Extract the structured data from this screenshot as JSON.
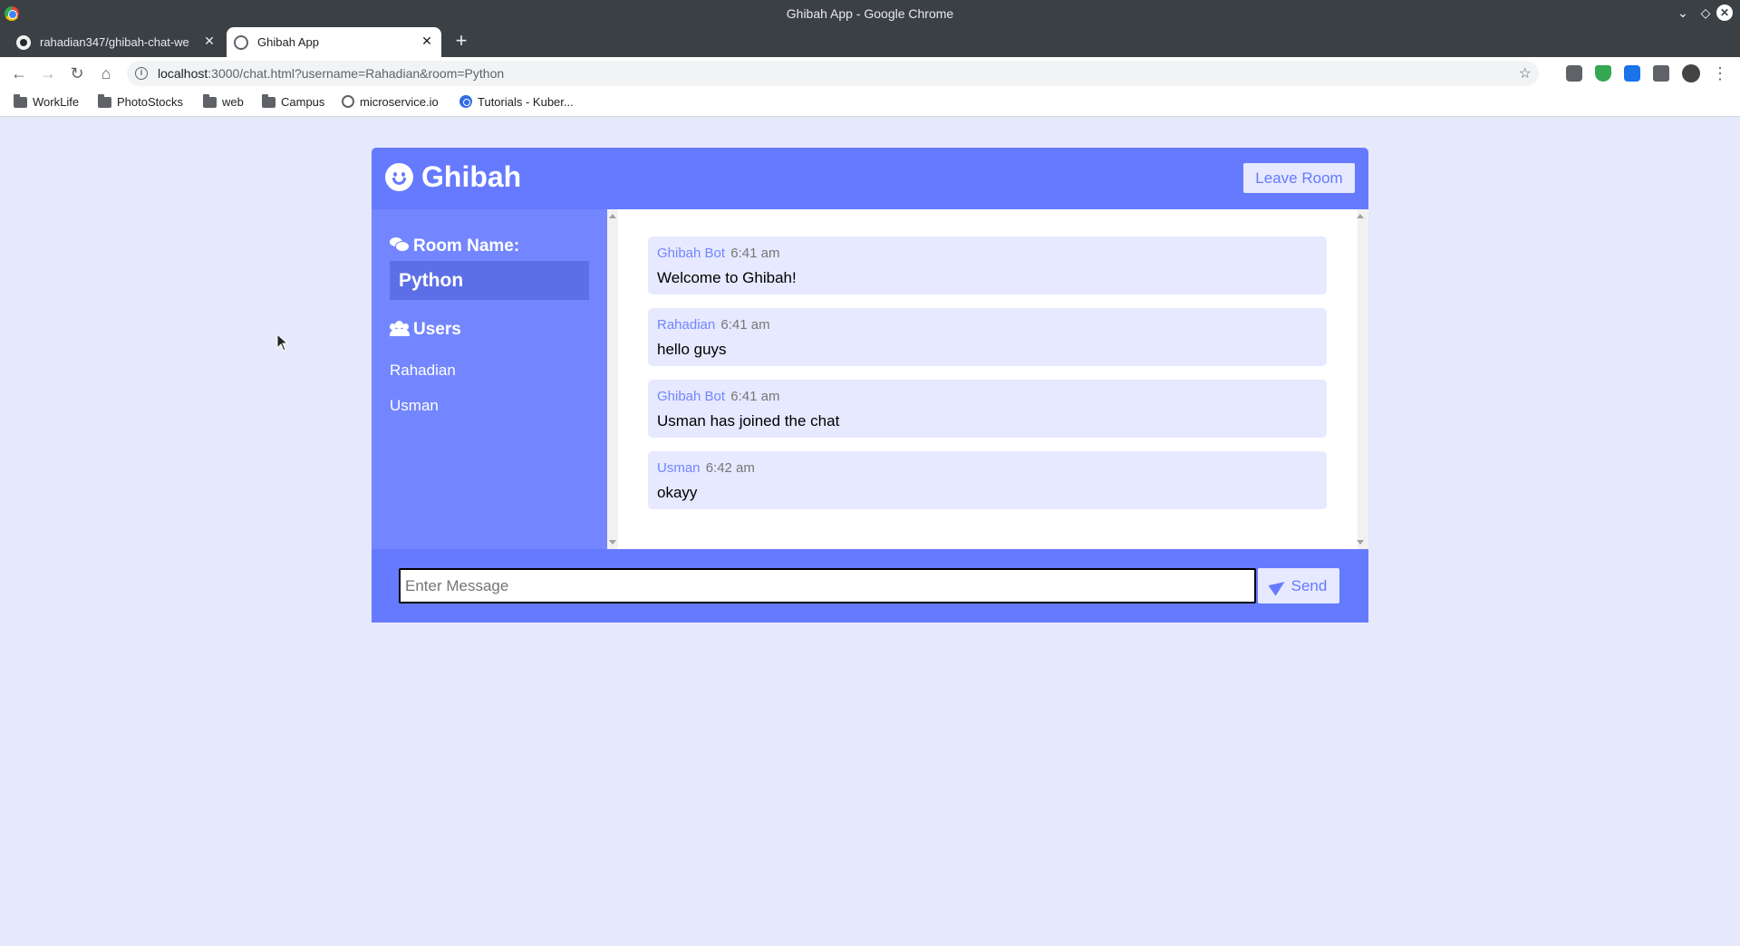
{
  "window": {
    "title": "Ghibah App - Google Chrome",
    "controls": {
      "minimize": "⌄",
      "maximize": "◇",
      "close": "✕"
    }
  },
  "tabs": [
    {
      "label": "rahadian347/ghibah-chat-we",
      "icon": "github-icon",
      "active": false
    },
    {
      "label": "Ghibah App",
      "icon": "globe-icon",
      "active": true
    }
  ],
  "toolbar": {
    "back": "←",
    "forward": "→",
    "reload": "↻",
    "home": "⌂",
    "url_host": "localhost",
    "url_rest": ":3000/chat.html?username=Rahadian&room=Python",
    "info": "i",
    "bookmark_star": "☆"
  },
  "bookmarks": [
    {
      "label": "WorkLife",
      "icon": "folder-icon"
    },
    {
      "label": "PhotoStocks",
      "icon": "folder-icon"
    },
    {
      "label": "web",
      "icon": "folder-icon"
    },
    {
      "label": "Campus",
      "icon": "folder-icon"
    },
    {
      "label": "microservice.io",
      "icon": "globe-icon"
    },
    {
      "label": "Tutorials - Kuber...",
      "icon": "kubernetes-icon"
    }
  ],
  "chat": {
    "app_title": "Ghibah",
    "leave_button": "Leave Room",
    "sidebar": {
      "room_heading": "Room Name:",
      "room_name": "Python",
      "users_heading": "Users",
      "users": [
        "Rahadian",
        "Usman"
      ]
    },
    "messages": [
      {
        "author": "Ghibah Bot",
        "time": "6:41 am",
        "text": "Welcome to Ghibah!"
      },
      {
        "author": "Rahadian",
        "time": "6:41 am",
        "text": "hello guys"
      },
      {
        "author": "Ghibah Bot",
        "time": "6:41 am",
        "text": "Usman has joined the chat"
      },
      {
        "author": "Usman",
        "time": "6:42 am",
        "text": "okayy"
      }
    ],
    "input": {
      "placeholder": "Enter Message",
      "value": ""
    },
    "send_button": "Send"
  },
  "colors": {
    "accent": "#667aff",
    "sidebar": "#7386ff",
    "light": "#e6e9ff",
    "page_bg": "#e6e8fb"
  }
}
